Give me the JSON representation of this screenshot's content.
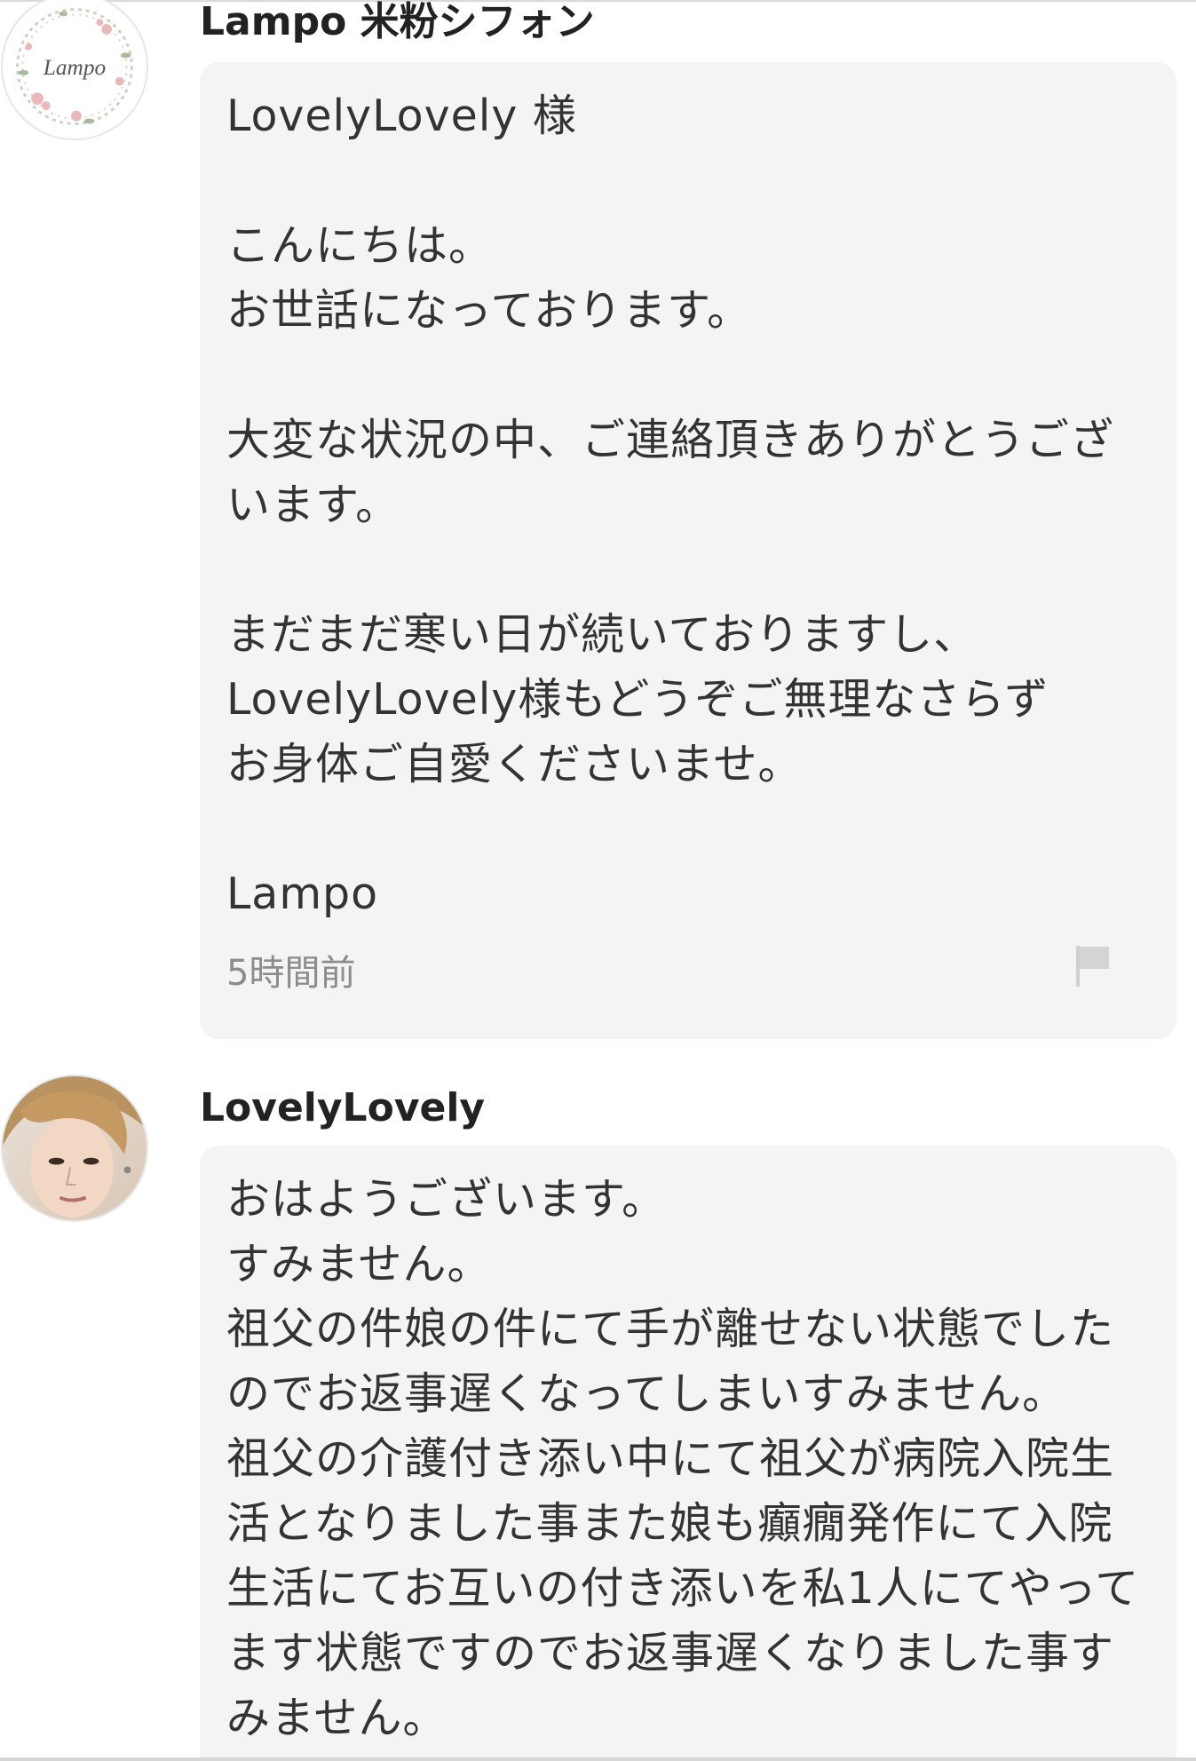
{
  "messages": [
    {
      "sender": "Lampo 米粉シフォン",
      "avatar_icon": "shop-logo-wreath-icon",
      "avatar_logo_text": "Lampo",
      "body": "LovelyLovely 様\n\nこんにちは。\nお世話になっております。\n\n大変な状況の中、ご連絡頂きありがとうございます。\n\nまだまだ寒い日が続いておりますし、\nLovelyLovely様もどうぞご無理なさらず\nお身体ご自愛くださいませ。\n\nLampo",
      "timestamp": "5時間前",
      "report_icon": "flag-icon"
    },
    {
      "sender": "LovelyLovely",
      "avatar_icon": "user-photo-avatar",
      "body": "おはようございます。\nすみません。\n祖父の件娘の件にて手が離せない状態でしたのでお返事遅くなってしまいすみません。\n祖父の介護付き添い中にて祖父が病院入院生活となりました事また娘も癲癇発作にて入院生活にてお互いの付き添いを私1人にてやってます状態ですのでお返事遅くなりました事すみません。"
    }
  ],
  "colors": {
    "bubble_background": "#f4f4f4",
    "timestamp": "#8c8c8c",
    "name_text": "#222222"
  }
}
